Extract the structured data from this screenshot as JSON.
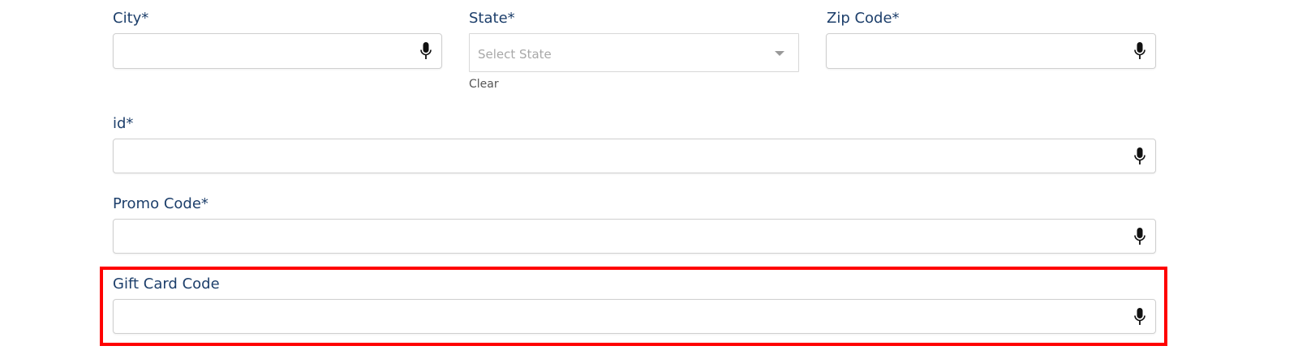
{
  "form": {
    "city": {
      "label": "City*",
      "value": "",
      "icon": "microphone-icon"
    },
    "state": {
      "label": "State*",
      "placeholder": "Select State",
      "clear_label": "Clear",
      "icon": "caret-down-icon"
    },
    "zip": {
      "label": "Zip Code*",
      "value": "",
      "icon": "microphone-icon"
    },
    "id_field": {
      "label": "id*",
      "value": "",
      "icon": "microphone-icon"
    },
    "promo": {
      "label": "Promo Code*",
      "value": "",
      "icon": "microphone-icon"
    },
    "gift": {
      "label": "Gift Card Code",
      "value": "",
      "icon": "microphone-icon"
    }
  },
  "colors": {
    "label": "#1d3f6b",
    "highlight": "#ff0000",
    "border": "#cfcfcf",
    "placeholder": "#a8a8a8"
  }
}
